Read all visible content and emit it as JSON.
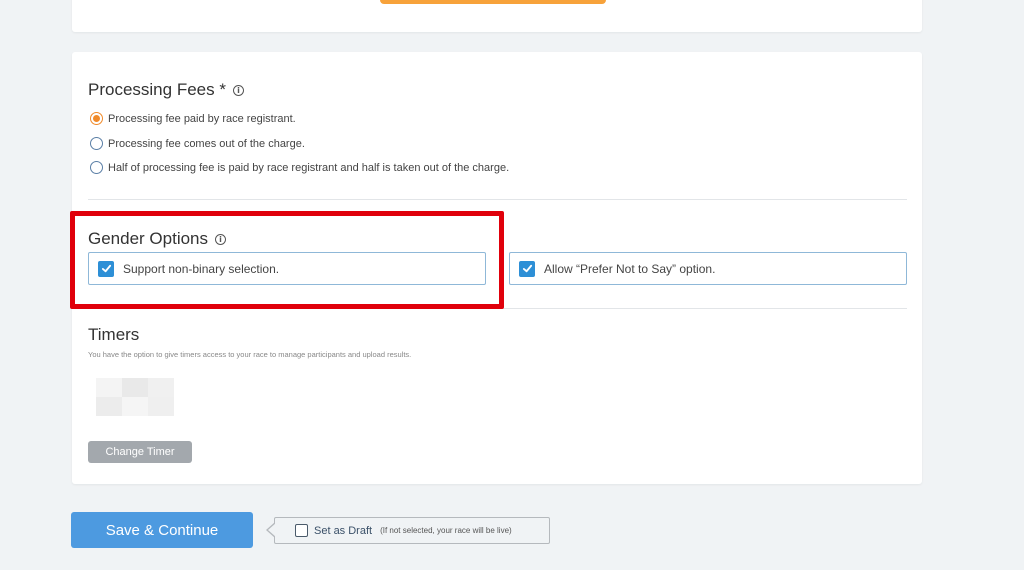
{
  "processing_fees": {
    "title": "Processing Fees *",
    "info_icon": "info-icon",
    "options": [
      {
        "label": "Processing fee paid by race registrant.",
        "selected": true
      },
      {
        "label": "Processing fee comes out of the charge.",
        "selected": false
      },
      {
        "label": "Half of processing fee is paid by race registrant and half is taken out of the charge.",
        "selected": false
      }
    ]
  },
  "gender_options": {
    "title": "Gender Options",
    "info_icon": "info-icon",
    "checkboxes": [
      {
        "label": "Support non-binary selection.",
        "checked": true
      },
      {
        "label": "Allow “Prefer Not to Say” option.",
        "checked": true
      }
    ]
  },
  "timers": {
    "title": "Timers",
    "description": "You have the option to give timers access to your race to manage participants and upload results.",
    "change_button": "Change Timer"
  },
  "footer": {
    "save_button": "Save & Continue",
    "draft_label": "Set as Draft",
    "draft_note": "(If not selected, your race will be live)"
  },
  "colors": {
    "accent_orange": "#f08a2a",
    "primary_blue": "#4d9ae0",
    "checkbox_blue": "#2d8fd6",
    "highlight_red": "#e0000b"
  }
}
